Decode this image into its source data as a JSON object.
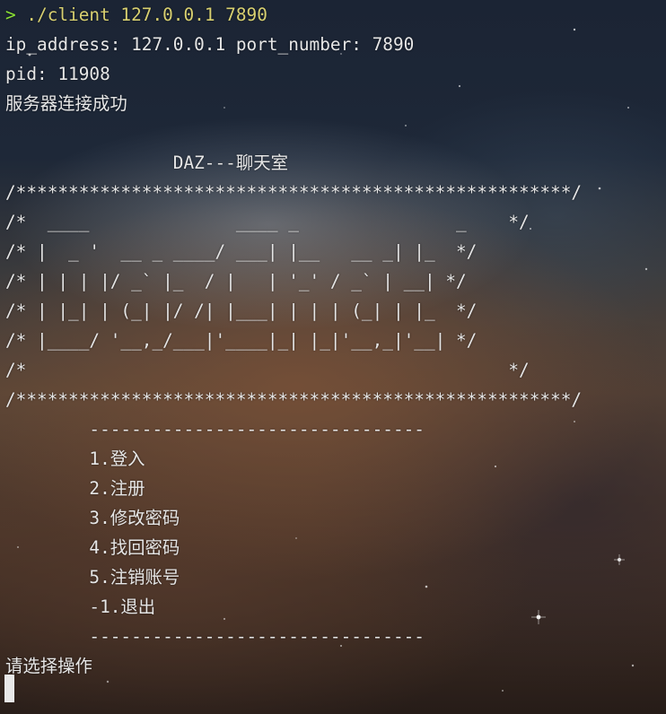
{
  "prompt": {
    "symbol": ">",
    "command": " ./client 127.0.0.1 7890"
  },
  "connection": {
    "address_line": "ip_address: 127.0.0.1 port_number: 7890",
    "pid_line": "pid: 11908",
    "status_line": "服务器连接成功"
  },
  "banner": {
    "title": "                DAZ---聊天室",
    "border_top": "/*****************************************************/",
    "art": [
      "/*  ____              ____ _               _    */",
      "/* |  _ '  __ _ ____/ ___| |__   __ _| |_  */",
      "/* | | | |/ _` |_  / |   | '_' / _` | __| */",
      "/* | |_| | (_| |/ /| |___| | | | (_| | |_  */",
      "/* |____/ '__,_/___|'____|_| |_|'__,_|'__| */",
      "/*                                              */"
    ],
    "border_bottom": "/*****************************************************/"
  },
  "menu": {
    "divider": "        --------------------------------",
    "items": [
      "        1.登入",
      "        2.注册",
      "        3.修改密码",
      "        4.找回密码",
      "        5.注销账号",
      "        -1.退出"
    ]
  },
  "input_prompt": "请选择操作"
}
